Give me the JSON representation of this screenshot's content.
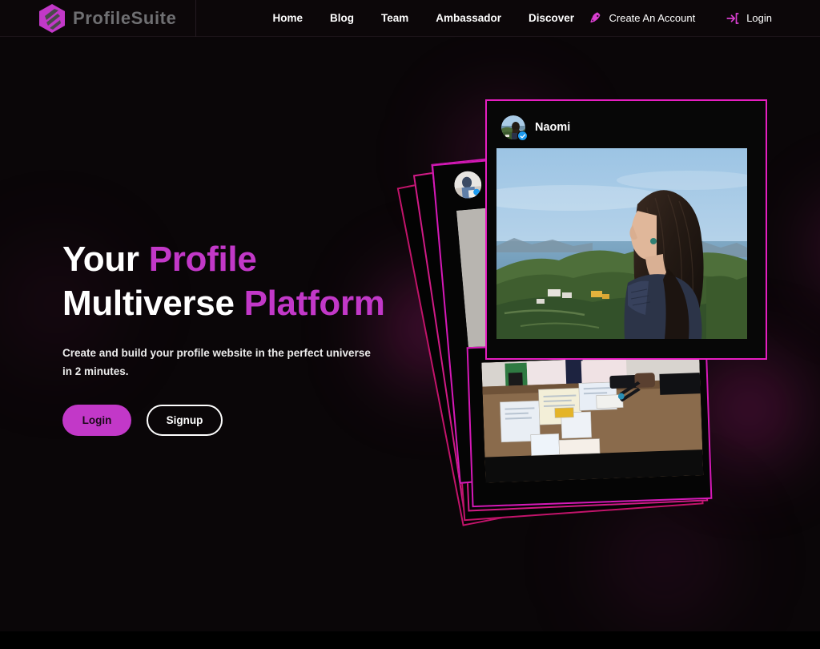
{
  "theme": {
    "accent": "#c238c8",
    "card_border": "#d619b8",
    "card_border_alt": "#c2146b",
    "background": "#0a0608",
    "header_background": "#0c0709",
    "text_primary": "#ffffff",
    "brand_text": "#6f6f72",
    "verified_blue": "#1d9bf0"
  },
  "header": {
    "brand": {
      "name": "ProfileSuite",
      "logo_icon": "hexagon-logo-icon"
    },
    "nav": [
      {
        "label": "Home",
        "name": "nav-link-home"
      },
      {
        "label": "Blog",
        "name": "nav-link-blog"
      },
      {
        "label": "Team",
        "name": "nav-link-team"
      },
      {
        "label": "Ambassador",
        "name": "nav-link-ambassador"
      },
      {
        "label": "Discover",
        "name": "nav-link-discover"
      }
    ],
    "actions": {
      "create_account": {
        "label": "Create An Account",
        "icon": "rocket-icon"
      },
      "login": {
        "label": "Login",
        "icon": "login-arrow-icon"
      }
    }
  },
  "hero": {
    "title_line1_plain": "Your ",
    "title_line1_accent": "Profile",
    "title_line2_plain": "Multiverse ",
    "title_line2_accent": "Platform",
    "subtitle": "Create and build your profile website in the perfect universe in 2 minutes.",
    "buttons": {
      "login": "Login",
      "signup": "Signup"
    }
  },
  "cards": {
    "front": {
      "username": "Naomi",
      "verified": true,
      "avatar_alt": "woman-overlooking-mountains-avatar",
      "photo_alt": "woman with long dark hair looking out over green mountains and blue sea"
    },
    "desk": {
      "photo_alt": "desk covered with printed documents, phone, scissors and keyboard"
    },
    "mid": {
      "verified": true,
      "avatar_alt": "person-at-desk-avatar"
    },
    "stack_count": 6
  }
}
